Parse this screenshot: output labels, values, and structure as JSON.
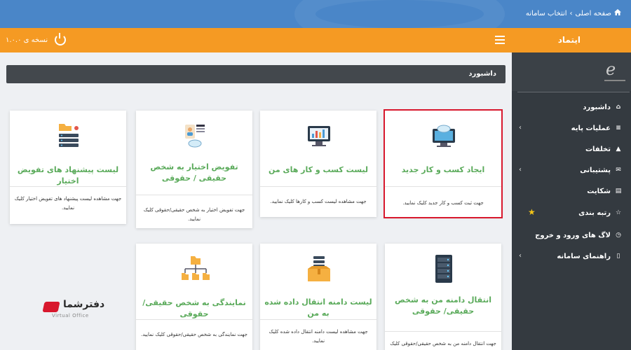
{
  "breadcrumb": {
    "home": "صفحه اصلی",
    "separator": "›",
    "current": "انتخاب سامانه"
  },
  "header": {
    "brand": "ایتماد",
    "version": "نسخه ی ۱.۰.۰"
  },
  "sidebar": {
    "items": [
      {
        "label": "داشبورد",
        "icon": "home-icon"
      },
      {
        "label": "عملیات پایه",
        "icon": "list-icon"
      },
      {
        "label": "تخلفات",
        "icon": "warning-icon"
      },
      {
        "label": "پشتیبانی",
        "icon": "chat-icon"
      },
      {
        "label": "شکایت",
        "icon": "document-icon"
      },
      {
        "label": "رتبه بندی",
        "icon": "star-icon"
      },
      {
        "label": "لاگ های ورود و خروج",
        "icon": "history-icon"
      },
      {
        "label": "راهنمای سامانه",
        "icon": "file-icon"
      }
    ]
  },
  "main": {
    "title": "داشبورد",
    "cards": [
      {
        "title": "ایجاد کسب و کار جدید",
        "desc": "جهت ثبت کسب و کار جدید کلیک نمایید.",
        "icon": "cloud-monitor-icon",
        "selected": true
      },
      {
        "title": "لیست کسب و کار های من",
        "desc": "جهت مشاهده لیست کسب و کارها کلیک نمایید.",
        "icon": "chart-monitor-icon"
      },
      {
        "title": "تفویض اختیار به شخص حقیقی / حقوقی",
        "desc": "جهت تفویض اختیار به شخص حقیقی/حقوقی کلیک نمایید.",
        "icon": "user-document-icon"
      },
      {
        "title": "لیست پیشنهاد های تفویض اختیار",
        "desc": "جهت مشاهده لیست پیشنهاد های تفویض اختیار کلیک نمایید.",
        "icon": "folder-server-icon"
      },
      {
        "title": "انتقال دامنه من به شخص حقیقی/ حقوقی",
        "desc": "جهت انتقال دامنه من به شخص حقیقی/حقوقی کلیک",
        "icon": "server-rack-icon"
      },
      {
        "title": "لیست دامنه انتقال داده شده به من",
        "desc": "جهت مشاهده لیست دامنه انتقال داده شده کلیک نمایید.",
        "icon": "box-server-icon"
      },
      {
        "title": "نمایندگی به شخص حقیقی/حقوقی",
        "desc": "جهت نمایندگی به شخص حقیقی/حقوقی کلیک نمایید.",
        "icon": "folder-network-icon"
      }
    ]
  },
  "watermark": {
    "name": "دفترشما",
    "sub": "Virtual Office"
  }
}
